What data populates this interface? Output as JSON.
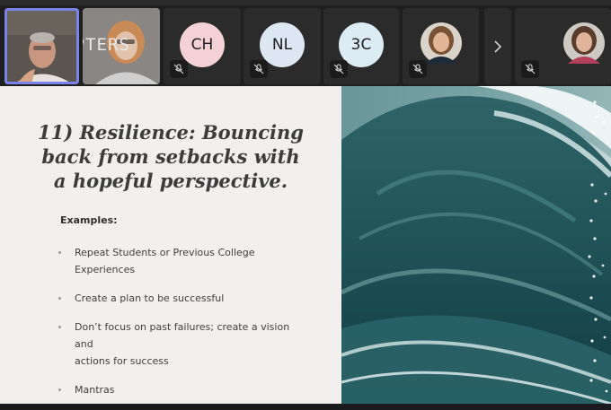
{
  "participants": [
    {
      "name_overlay": "ITHENTPTERS"
    },
    {
      "initials": "CH",
      "muted": true,
      "avatar_color": "#f4d1d4"
    },
    {
      "initials": "NL",
      "muted": true,
      "avatar_color": "#dce7f3"
    },
    {
      "initials": "3C",
      "muted": true,
      "avatar_color": "#dcecf4"
    }
  ],
  "slide": {
    "title_lines": [
      "11) Resilience: Bouncing",
      "back from setbacks with",
      "a hopeful perspective."
    ],
    "examples_label": "Examples:",
    "bullets": [
      {
        "line1": "Repeat Students or Previous College",
        "line2": "Experiences"
      },
      {
        "line1": "Create a plan to be successful",
        "line2": ""
      },
      {
        "line1": "Don’t focus on past failures; create a vision and",
        "line2": "actions for success"
      },
      {
        "line1": "Mantras",
        "line2": ""
      }
    ]
  },
  "colors": {
    "accent": "#7b83eb"
  }
}
